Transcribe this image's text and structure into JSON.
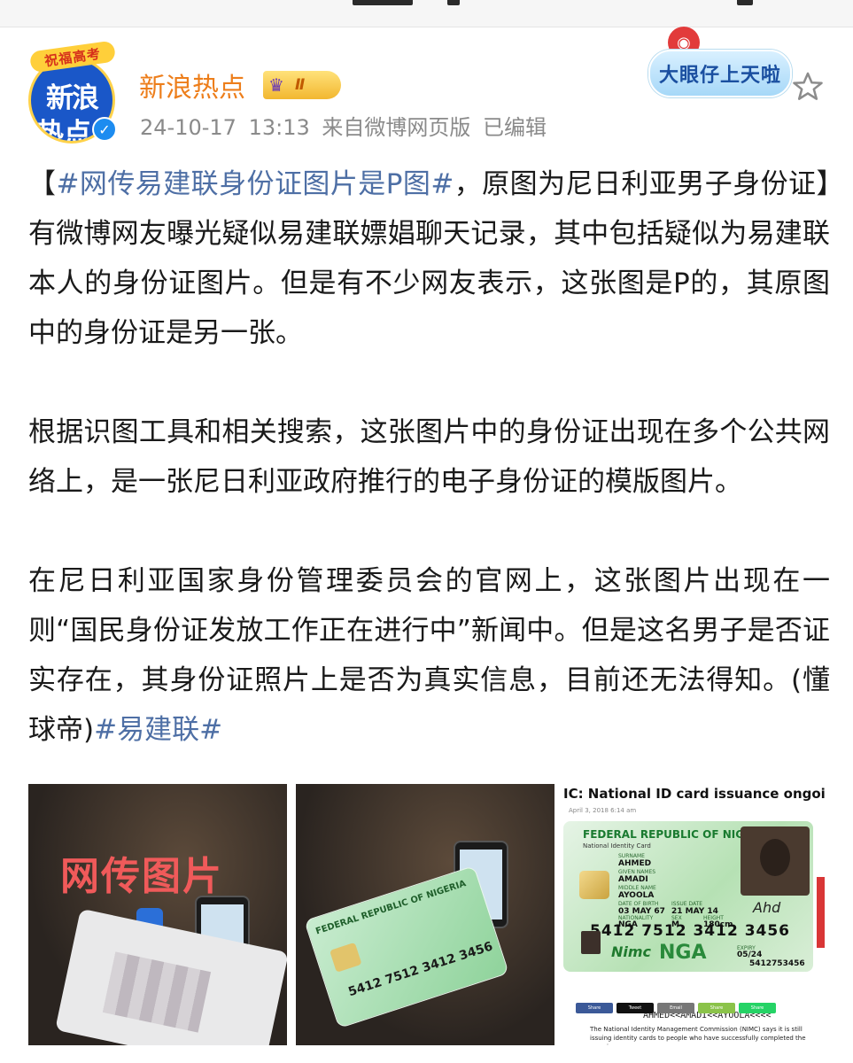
{
  "post": {
    "author": {
      "name": "新浪热点",
      "avatar_banner": "祝福高考",
      "avatar_line1": "新浪",
      "avatar_line2": "热点",
      "verified_mark": "✓",
      "vip_level": "Ⅱ"
    },
    "timestamp": "24-10-17 13:13",
    "source": "来自微博网页版",
    "edited": "已编辑",
    "sticker": {
      "label": "大眼仔上天啦"
    },
    "paragraphs": {
      "p1_lead": "【",
      "p1_topic": "#网传易建联身份证图片是P图#",
      "p1_text": "，原图为尼日利亚男子身份证】有微博网友曝光疑似易建联嫖娼聊天记录，其中包括疑似为易建联本人的身份证图片。但是有不少网友表示，这张图是P的，其原图中的身份证是另一张。",
      "p2": "根据识图工具和相关搜索，这张图片中的身份证出现在多个公共网络上，是一张尼日利亚政府推行的电子身份证的模版图片。",
      "p3_text": "在尼日利亚国家身份管理委员会的官网上，这张图片出现在一则“国民身份证发放工作正在进行中”新闻中。但是这名男子是否证实存在，其身份证照片上是否为真实信息，目前还无法得知。(懂球帝)",
      "p3_topic": "#易建联#"
    },
    "images": {
      "img1_overlay": "网传图片",
      "img2_card_title": "FEDERAL REPUBLIC OF NIGERIA",
      "img2_card_number": "5412 7512 3412 3456",
      "img3_headline": "IC: National ID card issuance ongoing",
      "img3_subline": "April 3, 2018 6:14 am",
      "card": {
        "title": "FEDERAL REPUBLIC OF NIGERIA",
        "subtitle": "National Identity Card",
        "surname_label": "SURNAME",
        "surname": "AHMED",
        "given_label": "GIVEN NAMES",
        "given": "AMADI",
        "middle_label": "MIDDLE NAME",
        "middle": "AYOOLA",
        "dob_label": "DATE OF BIRTH",
        "dob": "03 MAY 67",
        "nat_label": "NATIONALITY",
        "nat": "NGA",
        "issue_label": "ISSUE DATE",
        "issue": "21 MAY 14",
        "sex_label": "SEX",
        "sex": "M",
        "height_label": "HEIGHT",
        "height": "180cm",
        "nin": "5412 7512 3412 3456",
        "nimc": "Nimc",
        "nga": "NGA",
        "expiry_label": "EXPIRY",
        "expiry": "05/24",
        "doc_no": "5412753456",
        "mrz": "AHMED<<AMADI<<AYOOLA<<<<",
        "signature": "Ahd"
      },
      "share_buttons": [
        "Share",
        "Tweet",
        "Email",
        "Share",
        "Share"
      ],
      "caption": "The National Identity Management Commission (NIMC) says it is still issuing identity cards to people who have successfully completed the exercise."
    }
  },
  "colors": {
    "username": "#ed7e1b",
    "link": "#4e6fa5",
    "meta": "#8a8a8a",
    "text": "#1a1a1a"
  }
}
